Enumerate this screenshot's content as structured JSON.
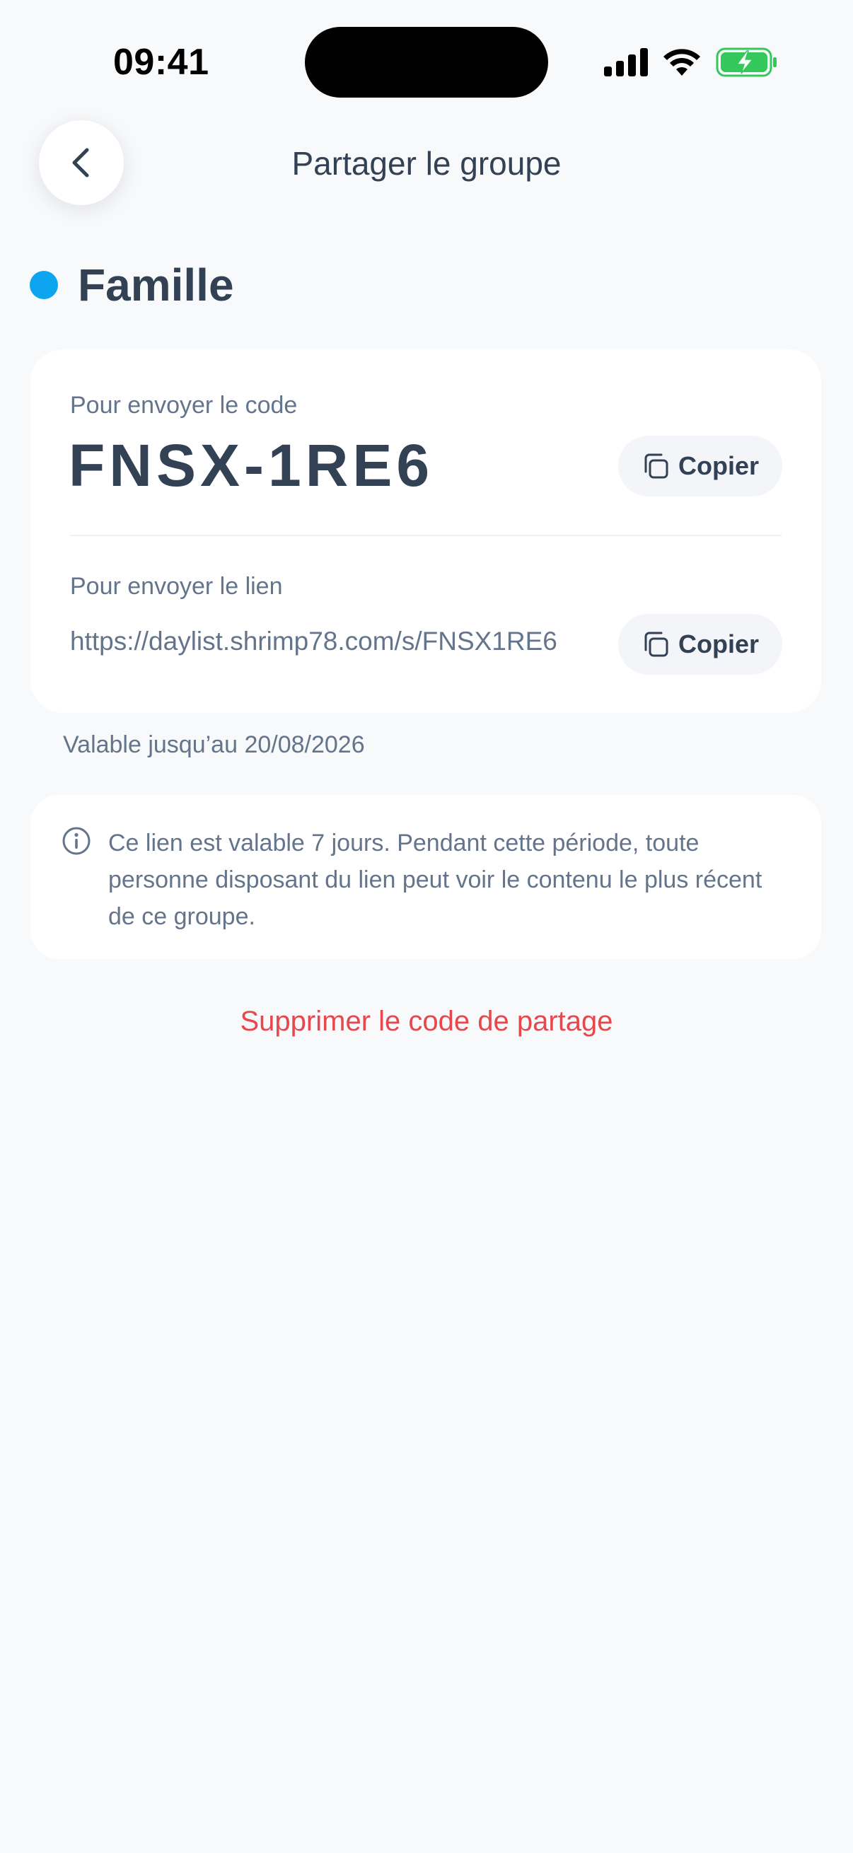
{
  "status_bar": {
    "time": "09:41",
    "icons": [
      "cellular-signal-icon",
      "wifi-icon",
      "battery-charging-icon"
    ],
    "battery_color": "#34c759"
  },
  "header": {
    "title": "Partager le groupe",
    "back_icon": "chevron-left-icon"
  },
  "group": {
    "name": "Famille",
    "color": "#0ea5f0"
  },
  "share_card": {
    "code_label": "Pour envoyer le code",
    "code": "FNSX-1RE6",
    "link_label": "Pour envoyer le lien",
    "link": "https://daylist.shrimp78.com/s/FNSX1RE6",
    "copy_label": "Copier",
    "copy_icon": "copy-icon"
  },
  "validity": "Valable jusqu’au 20/08/2026",
  "info": {
    "icon": "info-icon",
    "text": "Ce lien est valable 7 jours. Pendant cette période, toute personne disposant du lien peut voir le contenu le plus récent de ce groupe."
  },
  "delete_label": "Supprimer le code de partage",
  "colors": {
    "background": "#f8f9fb",
    "card": "#ffffff",
    "text_primary": "#334155",
    "text_secondary": "#64748b",
    "danger": "#e5484d"
  }
}
